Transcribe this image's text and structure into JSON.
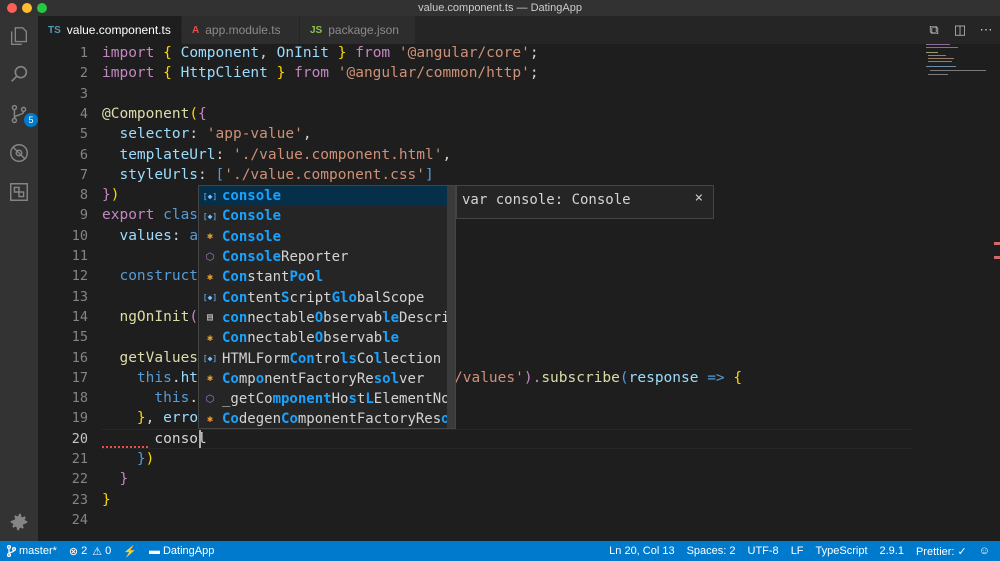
{
  "window": {
    "title": "value.component.ts — DatingApp"
  },
  "activity_bar": {
    "items": [
      {
        "name": "explorer-icon"
      },
      {
        "name": "search-icon"
      },
      {
        "name": "source-control-icon",
        "badge": "5"
      },
      {
        "name": "debug-icon"
      },
      {
        "name": "extensions-icon"
      }
    ],
    "settings": "gear-icon"
  },
  "tabs": [
    {
      "label": "value.component.ts",
      "icon": "TS",
      "icon_color": "#519aba",
      "active": true
    },
    {
      "label": "app.module.ts",
      "icon": "A",
      "icon_color": "#e34c4c",
      "active": false
    },
    {
      "label": "package.json",
      "icon": "JS",
      "icon_color": "#8bc34a",
      "active": false
    }
  ],
  "editor": {
    "line_numbers": [
      "1",
      "2",
      "3",
      "4",
      "5",
      "6",
      "7",
      "8",
      "9",
      "10",
      "11",
      "12",
      "13",
      "14",
      "15",
      "16",
      "17",
      "18",
      "19",
      "20",
      "21",
      "22",
      "23",
      "24"
    ],
    "current_line": "20",
    "lines": {
      "l1_import": "import",
      "l1_open": " { ",
      "l1_component": "Component",
      "l1_comma": ", ",
      "l1_oninit": "OnInit",
      "l1_close": " } ",
      "l1_from": "from",
      "l1_str": " '@angular/core'",
      "l1_semi": ";",
      "l2_import": "import",
      "l2_open": " { ",
      "l2_http": "HttpClient",
      "l2_close": " } ",
      "l2_from": "from",
      "l2_str": " '@angular/common/http'",
      "l2_semi": ";",
      "l4_at": "@",
      "l4_component": "Component",
      "l4_paren": "(",
      "l4_brace": "{",
      "l5_key": "  selector",
      "l5_colon": ": ",
      "l5_str": "'app-value'",
      "l5_comma": ",",
      "l6_key": "  templateUrl",
      "l6_colon": ": ",
      "l6_str": "'./value.component.html'",
      "l6_comma": ",",
      "l7_key": "  styleUrls",
      "l7_colon": ": ",
      "l7_br": "[",
      "l7_str": "'./value.component.css'",
      "l7_brc": "]",
      "l8_brace": "}",
      "l8_paren": ")",
      "l9_export": "export",
      "l9_class": " class",
      "l9_rest": " ",
      "l10_key": "  values",
      "l10_colon": ": ",
      "l10_rest": "an",
      "l12_rest": "  constructo",
      "l14_fn": "  ngOnInit",
      "l14_paren": "()",
      "l16_fn": "  getValues",
      "l16_paren": "(",
      "l17_this": "    this",
      "l17_dot": ".",
      "l17_htt": "htt",
      "l17_str": "/values'",
      "l17_paren": ").",
      "l17_subscribe": "subscribe",
      "l17_open": "(",
      "l17_resp": "response",
      "l17_arrow": " => ",
      "l17_brace": "{",
      "l18_this": "      this",
      "l18_dot": ".",
      "l18_v": "v",
      "l19_close": "    }",
      "l19_comma": ", ",
      "l19_error": "error",
      "l20_text": "      consol",
      "l21_close": "    }",
      "l21_paren": ")",
      "l22_close": "  }",
      "l23_close": "}"
    }
  },
  "suggest": {
    "items": [
      {
        "icon": "variable-icon",
        "parts": [
          [
            "console",
            true
          ]
        ]
      },
      {
        "icon": "variable-icon",
        "parts": [
          [
            "Console",
            true
          ]
        ]
      },
      {
        "icon": "class-icon",
        "parts": [
          [
            "Console",
            true
          ]
        ]
      },
      {
        "icon": "module-icon",
        "parts": [
          [
            "Console",
            true
          ],
          [
            "Reporter",
            false
          ]
        ]
      },
      {
        "icon": "class-icon",
        "parts": [
          [
            "Con",
            true
          ],
          [
            "stant",
            false
          ],
          [
            "Po",
            true
          ],
          [
            "o",
            false
          ],
          [
            "l",
            true
          ]
        ]
      },
      {
        "icon": "variable-icon",
        "parts": [
          [
            "Con",
            true
          ],
          [
            "tent",
            false
          ],
          [
            "S",
            true
          ],
          [
            "cript",
            false
          ],
          [
            "Glo",
            true
          ],
          [
            "balScope",
            false
          ]
        ]
      },
      {
        "icon": "interface-icon",
        "parts": [
          [
            "con",
            true
          ],
          [
            "nectable",
            false
          ],
          [
            "O",
            true
          ],
          [
            "bservab",
            false
          ],
          [
            "le",
            true
          ],
          [
            "Descript",
            false
          ]
        ]
      },
      {
        "icon": "class-icon",
        "parts": [
          [
            "Con",
            true
          ],
          [
            "nectable",
            false
          ],
          [
            "O",
            true
          ],
          [
            "bservab",
            false
          ],
          [
            "le",
            true
          ]
        ]
      },
      {
        "icon": "variable-icon",
        "parts": [
          [
            "HTMLForm",
            false
          ],
          [
            "Con",
            true
          ],
          [
            "tro",
            false
          ],
          [
            "ls",
            true
          ],
          [
            "Co",
            false
          ],
          [
            "l",
            true
          ],
          [
            "lection",
            false
          ]
        ]
      },
      {
        "icon": "class-icon",
        "parts": [
          [
            "Co",
            true
          ],
          [
            "mp",
            false
          ],
          [
            "o",
            true
          ],
          [
            "nentFactoryRe",
            false
          ],
          [
            "sol",
            true
          ],
          [
            "ver",
            false
          ]
        ]
      },
      {
        "icon": "module-icon",
        "parts": [
          [
            "_getCo",
            false
          ],
          [
            "mponent",
            true
          ],
          [
            "Ho",
            false
          ],
          [
            "s",
            true
          ],
          [
            "t",
            false
          ],
          [
            "L",
            true
          ],
          [
            "ElementNode",
            false
          ]
        ]
      },
      {
        "icon": "class-icon",
        "parts": [
          [
            "Co",
            true
          ],
          [
            "degen",
            false
          ],
          [
            "Co",
            true
          ],
          [
            "mponentFactoryRes",
            false
          ],
          [
            "ol",
            true
          ],
          [
            "v",
            false
          ]
        ]
      }
    ],
    "detail": "var console: Console",
    "detail_close": "×"
  },
  "status_bar": {
    "branch": "master*",
    "errors": "2",
    "warnings": "0",
    "folder": "DatingApp",
    "position": "Ln 20, Col 13",
    "spaces": "Spaces: 2",
    "encoding": "UTF-8",
    "eol": "LF",
    "language": "TypeScript",
    "version": "2.9.1",
    "prettier": "Prettier: ✓"
  },
  "colors": {
    "accent": "#007acc",
    "highlight": "#18a3ff",
    "error": "#f14c4c"
  }
}
